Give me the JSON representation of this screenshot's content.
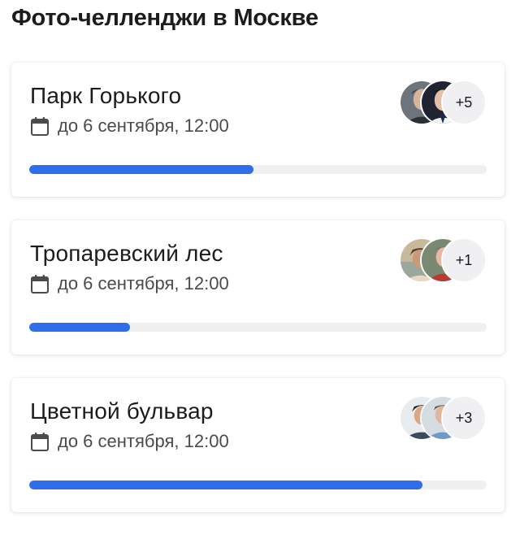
{
  "page": {
    "title": "Фото-челленджи в Москве"
  },
  "colors": {
    "accent": "#2f6eea",
    "track": "#f0f0f2",
    "text": "#1c1c1e",
    "muted": "#4a4a4f"
  },
  "challenges": [
    {
      "title": "Парк Горького",
      "deadline": "до 6 сентября, 12:00",
      "extra_participants": "+5",
      "progress": 0.49,
      "icon": "calendar-icon"
    },
    {
      "title": "Тропаревский лес",
      "deadline": "до 6 сентября, 12:00",
      "extra_participants": "+1",
      "progress": 0.22,
      "icon": "calendar-icon"
    },
    {
      "title": "Цветной бульвар",
      "deadline": "до 6 сентября, 12:00",
      "extra_participants": "+3",
      "progress": 0.86,
      "icon": "calendar-icon"
    }
  ]
}
